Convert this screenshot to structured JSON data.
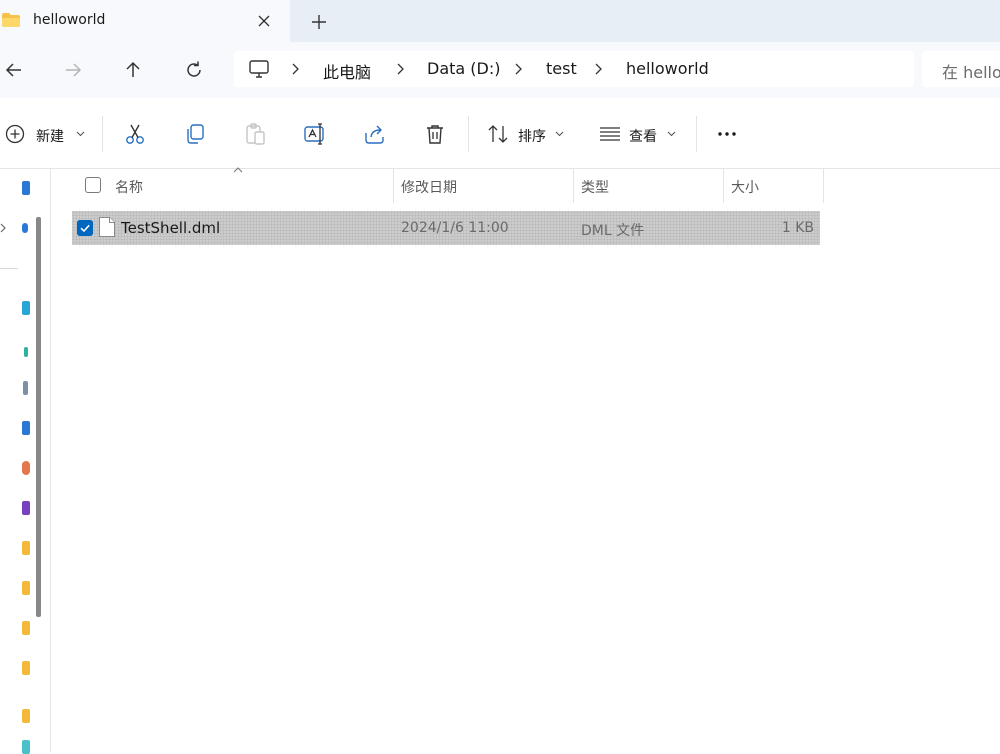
{
  "tab": {
    "title": "helloworld"
  },
  "breadcrumb": {
    "items": [
      "此电脑",
      "Data (D:)",
      "test",
      "helloworld"
    ]
  },
  "search": {
    "placeholder": "在 helloworld 中搜索"
  },
  "toolbar": {
    "new_label": "新建",
    "sort_label": "排序",
    "view_label": "查看"
  },
  "columns": {
    "name": "名称",
    "modified": "修改日期",
    "type": "类型",
    "size": "大小"
  },
  "files": [
    {
      "name": "TestShell.dml",
      "modified": "2024/1/6 11:00",
      "type": "DML 文件",
      "size": "1 KB",
      "selected": true
    }
  ],
  "colors": {
    "accent": "#0067c0",
    "folder": "#f7c24a",
    "selection": "#cccccc"
  },
  "icons": [
    "folder-icon",
    "close-icon",
    "plus-icon",
    "back-arrow-icon",
    "forward-arrow-icon",
    "up-arrow-icon",
    "refresh-icon",
    "computer-icon",
    "chevron-right-icon",
    "new-icon",
    "cut-icon",
    "copy-icon",
    "paste-icon",
    "rename-icon",
    "share-icon",
    "delete-icon",
    "sort-icon",
    "view-icon",
    "more-icon",
    "file-icon",
    "checkbox-icon"
  ]
}
